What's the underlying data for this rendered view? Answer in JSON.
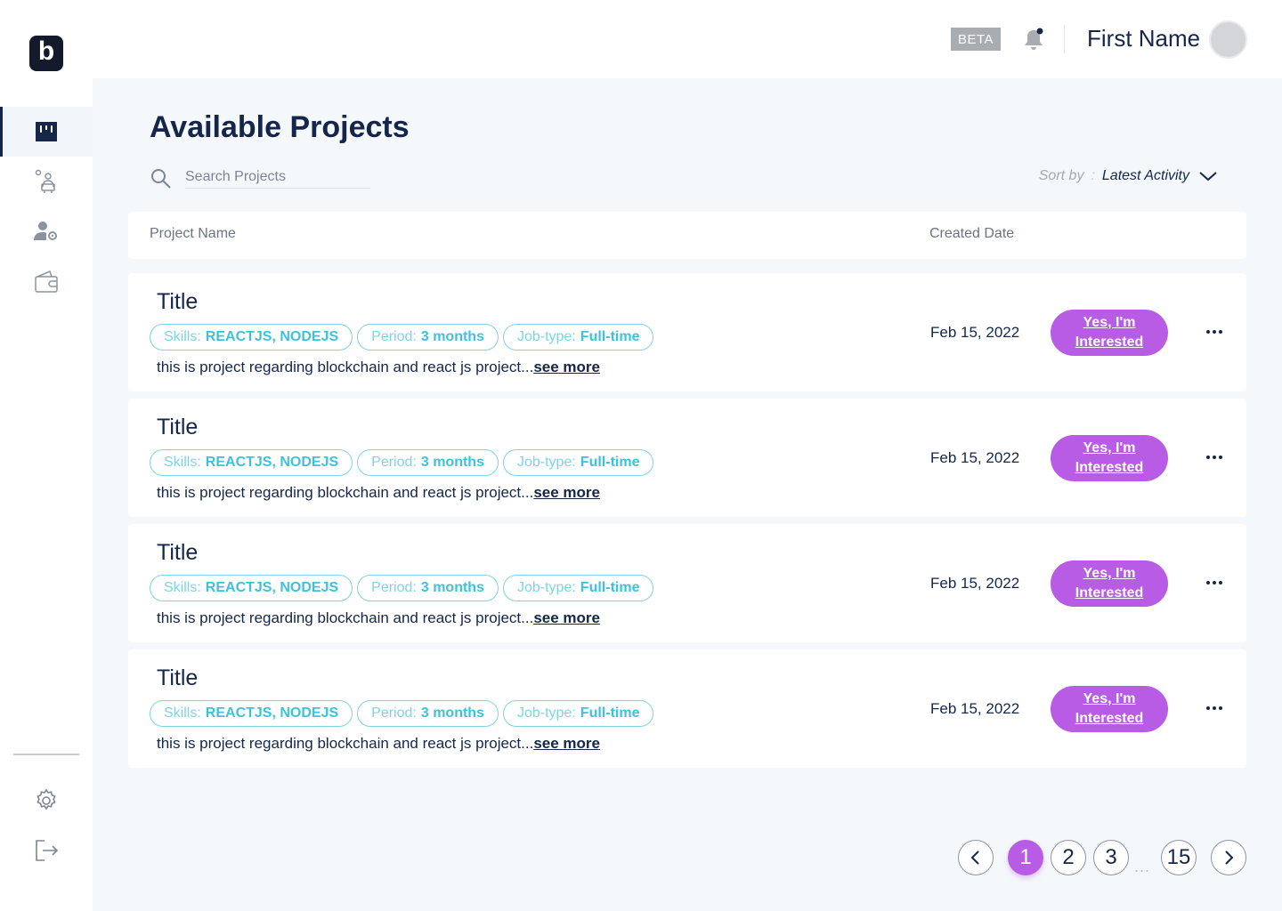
{
  "brand": {
    "logo_letter": "b"
  },
  "topbar": {
    "beta_label": "BETA",
    "username": "First Name"
  },
  "sidebar": {
    "items": [
      {
        "icon": "projects-board-icon",
        "active": true
      },
      {
        "icon": "team-people-icon",
        "active": false
      },
      {
        "icon": "user-settings-icon",
        "active": false
      },
      {
        "icon": "wallet-icon",
        "active": false
      }
    ],
    "bottom": [
      {
        "icon": "gear-icon"
      },
      {
        "icon": "logout-icon"
      }
    ]
  },
  "page": {
    "title": "Available Projects",
    "search_placeholder": "Search Projects",
    "sort": {
      "label": "Sort by",
      "separator": ":",
      "value": "Latest Activity"
    }
  },
  "table": {
    "columns": [
      "Project Name",
      "Created Date"
    ],
    "rows": [
      {
        "title": "Title",
        "skills_label": "Skills:",
        "skills": "REACTJS, NODEJS",
        "period_label": "Period:",
        "period": "3 months",
        "jobtype_label": "Job-type:",
        "jobtype": "Full-time",
        "description": "this is project regarding blockchain and react js project...",
        "see_more": "see more",
        "date": "Feb 15, 2022",
        "cta": "Yes, I'm Interested"
      },
      {
        "title": "Title",
        "skills_label": "Skills:",
        "skills": "REACTJS, NODEJS",
        "period_label": "Period:",
        "period": "3 months",
        "jobtype_label": "Job-type:",
        "jobtype": "Full-time",
        "description": "this is project regarding blockchain and react js project...",
        "see_more": "see more",
        "date": "Feb 15, 2022",
        "cta": "Yes, I'm Interested"
      },
      {
        "title": "Title",
        "skills_label": "Skills:",
        "skills": "REACTJS, NODEJS",
        "period_label": "Period:",
        "period": "3 months",
        "jobtype_label": "Job-type:",
        "jobtype": "Full-time",
        "description": "this is project regarding blockchain and react js project...",
        "see_more": "see more",
        "date": "Feb 15, 2022",
        "cta": "Yes, I'm Interested"
      },
      {
        "title": "Title",
        "skills_label": "Skills:",
        "skills": "REACTJS, NODEJS",
        "period_label": "Period:",
        "period": "3 months",
        "jobtype_label": "Job-type:",
        "jobtype": "Full-time",
        "description": "this is project regarding blockchain and react js project...",
        "see_more": "see more",
        "date": "Feb 15, 2022",
        "cta": "Yes, I'm Interested"
      }
    ]
  },
  "pagination": {
    "pages": [
      "1",
      "2",
      "3"
    ],
    "ellipsis": "...",
    "last": "15",
    "current": "1"
  },
  "colors": {
    "primary_dark": "#15264a",
    "accent_purple": "#b85ce6",
    "chip_cyan": "#3ec2dc",
    "background": "#f4f8fb"
  }
}
